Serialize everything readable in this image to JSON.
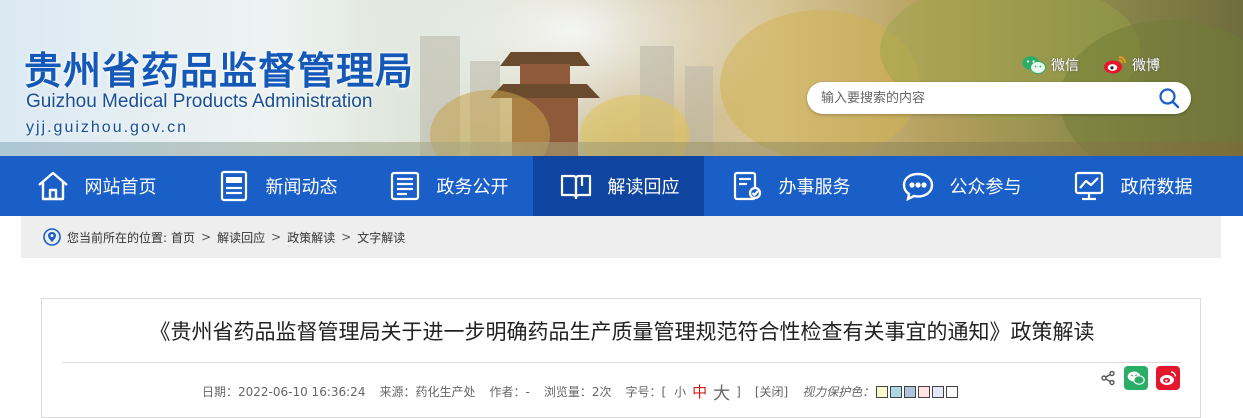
{
  "header": {
    "title_cn": "贵州省药品监督管理局",
    "title_en": "Guizhou Medical Products Administration",
    "url": "yjj.guizhou.gov.cn",
    "social": [
      {
        "label": "微信",
        "icon": "wechat-icon"
      },
      {
        "label": "微博",
        "icon": "weibo-icon"
      }
    ],
    "search": {
      "placeholder": "输入要搜索的内容",
      "icon": "search-icon"
    }
  },
  "nav": {
    "items": [
      {
        "label": "网站首页",
        "icon": "home-icon"
      },
      {
        "label": "新闻动态",
        "icon": "news-icon"
      },
      {
        "label": "政务公开",
        "icon": "document-list-icon"
      },
      {
        "label": "解读回应",
        "icon": "open-book-icon",
        "active": true
      },
      {
        "label": "办事服务",
        "icon": "service-form-icon"
      },
      {
        "label": "公众参与",
        "icon": "chat-bubble-icon"
      },
      {
        "label": "政府数据",
        "icon": "data-monitor-icon"
      }
    ]
  },
  "breadcrumb": {
    "prefix": "您当前所在的位置:",
    "items": [
      "首页",
      "解读回应",
      "政策解读",
      "文字解读"
    ],
    "separator": ">"
  },
  "article": {
    "title": "《贵州省药品监督管理局关于进一步明确药品生产质量管理规范符合性检查有关事宜的通知》政策解读",
    "meta": {
      "date": "日期：2022-06-10 16:36:24",
      "source": "来源：药化生产处",
      "author": "作者：-",
      "views": "浏览量：2次",
      "font_size_label": "字号：[",
      "font_small": "小",
      "font_medium": "中",
      "font_large": "大",
      "font_size_close": "]",
      "close": "[关闭]",
      "eye_protect": "视力保护色："
    },
    "eye_colors": [
      "#fafad2",
      "#add8e6",
      "#b0c4de",
      "#ffe4e1",
      "#e6e6fa",
      "#ffffff"
    ],
    "share": [
      {
        "icon": "share-icon"
      },
      {
        "icon": "wechat-share-icon"
      },
      {
        "icon": "weibo-share-icon"
      }
    ]
  },
  "colors": {
    "nav_bg": "#1a5fc8",
    "nav_active": "#0f45a0",
    "title_blue": "#1459b8",
    "wechat_green": "#2aae67",
    "weibo_red": "#e6162d"
  }
}
